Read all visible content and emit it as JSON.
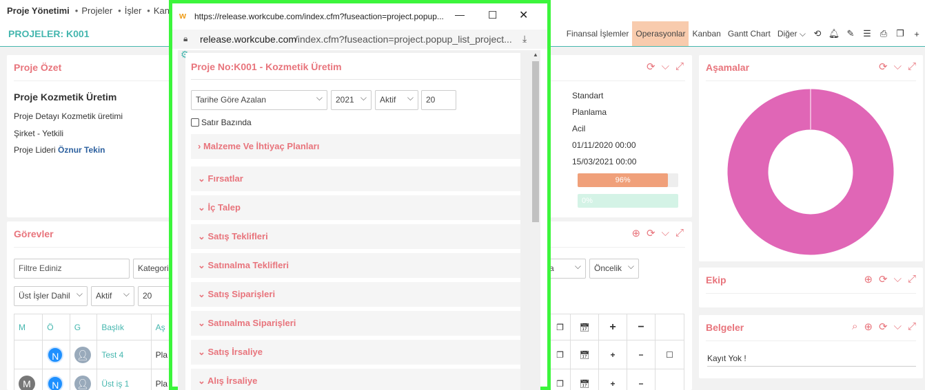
{
  "topnav": {
    "module": "Proje Yönetimi",
    "links": [
      "Projeler",
      "İşler",
      "Kanban"
    ]
  },
  "subbar": {
    "title": "PROJELER: K001",
    "menu": [
      "Finansal İşlemler",
      "Operasyonlar",
      "Kanban",
      "Gantt Chart",
      "Diğer"
    ],
    "active": "Operasyonlar"
  },
  "ozet": {
    "title": "Proje Özet",
    "project_name": "Proje Kozmetik Üretim",
    "detail": "Proje Detayı Kozmetik üretimi",
    "company": "Şirket - Yetkili",
    "leader_label": "Proje Lideri",
    "leader_name": "Öznur Tekin",
    "right": [
      "Standart",
      "Planlama",
      "Acil",
      "01/11/2020 00:00",
      "15/03/2021 00:00"
    ],
    "progress1": "96%",
    "progress1_value": 0.96,
    "progress2": "0%",
    "progress2_value": 0
  },
  "asamalar": {
    "title": "Aşamalar"
  },
  "ekip": {
    "title": "Ekip"
  },
  "belgeler": {
    "title": "Belgeler",
    "empty": "Kayıt Yok !"
  },
  "gorevler": {
    "title": "Görevler",
    "filter_placeholder": "Filtre Ediniz",
    "category": "Kategori",
    "priority": "Öncelik",
    "include": "Üst İşler Dahil",
    "status": "Aktif",
    "count": "20",
    "partial_a": "a",
    "headers": [
      "M",
      "Ö",
      "G",
      "Başlık",
      "Aş"
    ],
    "rows": [
      {
        "m": "",
        "o": "N",
        "title": "Test 4",
        "as": "Pla"
      },
      {
        "m": "M",
        "o": "N",
        "title": "Üst iş 1",
        "as": "Pla"
      }
    ]
  },
  "popup": {
    "window_title": "https://release.workcube.com/index.cfm?fuseaction=project.popup...",
    "url_domain": "release.workcube.com",
    "url_rest": "/index.cfm?fuseaction=project.popup_list_project...",
    "heading": "Proje No:K001 - Kozmetik Üretim",
    "sort": "Tarihe Göre Azalan",
    "year": "2021",
    "status": "Aktif",
    "count": "20",
    "row_based": "Satır Bazında",
    "sections": [
      "Malzeme Ve İhtiyaç Planları",
      "Fırsatlar",
      "İç Talep",
      "Satış Teklifleri",
      "Satınalma Teklifleri",
      "Satış Siparişleri",
      "Satınalma Siparişleri",
      "Satış İrsaliye",
      "Alış İrsaliye"
    ]
  },
  "colors": {
    "accent": "#44b6ae",
    "header": "#e8747c",
    "donut": "#e066b6",
    "highlight": "#3cf53c"
  }
}
